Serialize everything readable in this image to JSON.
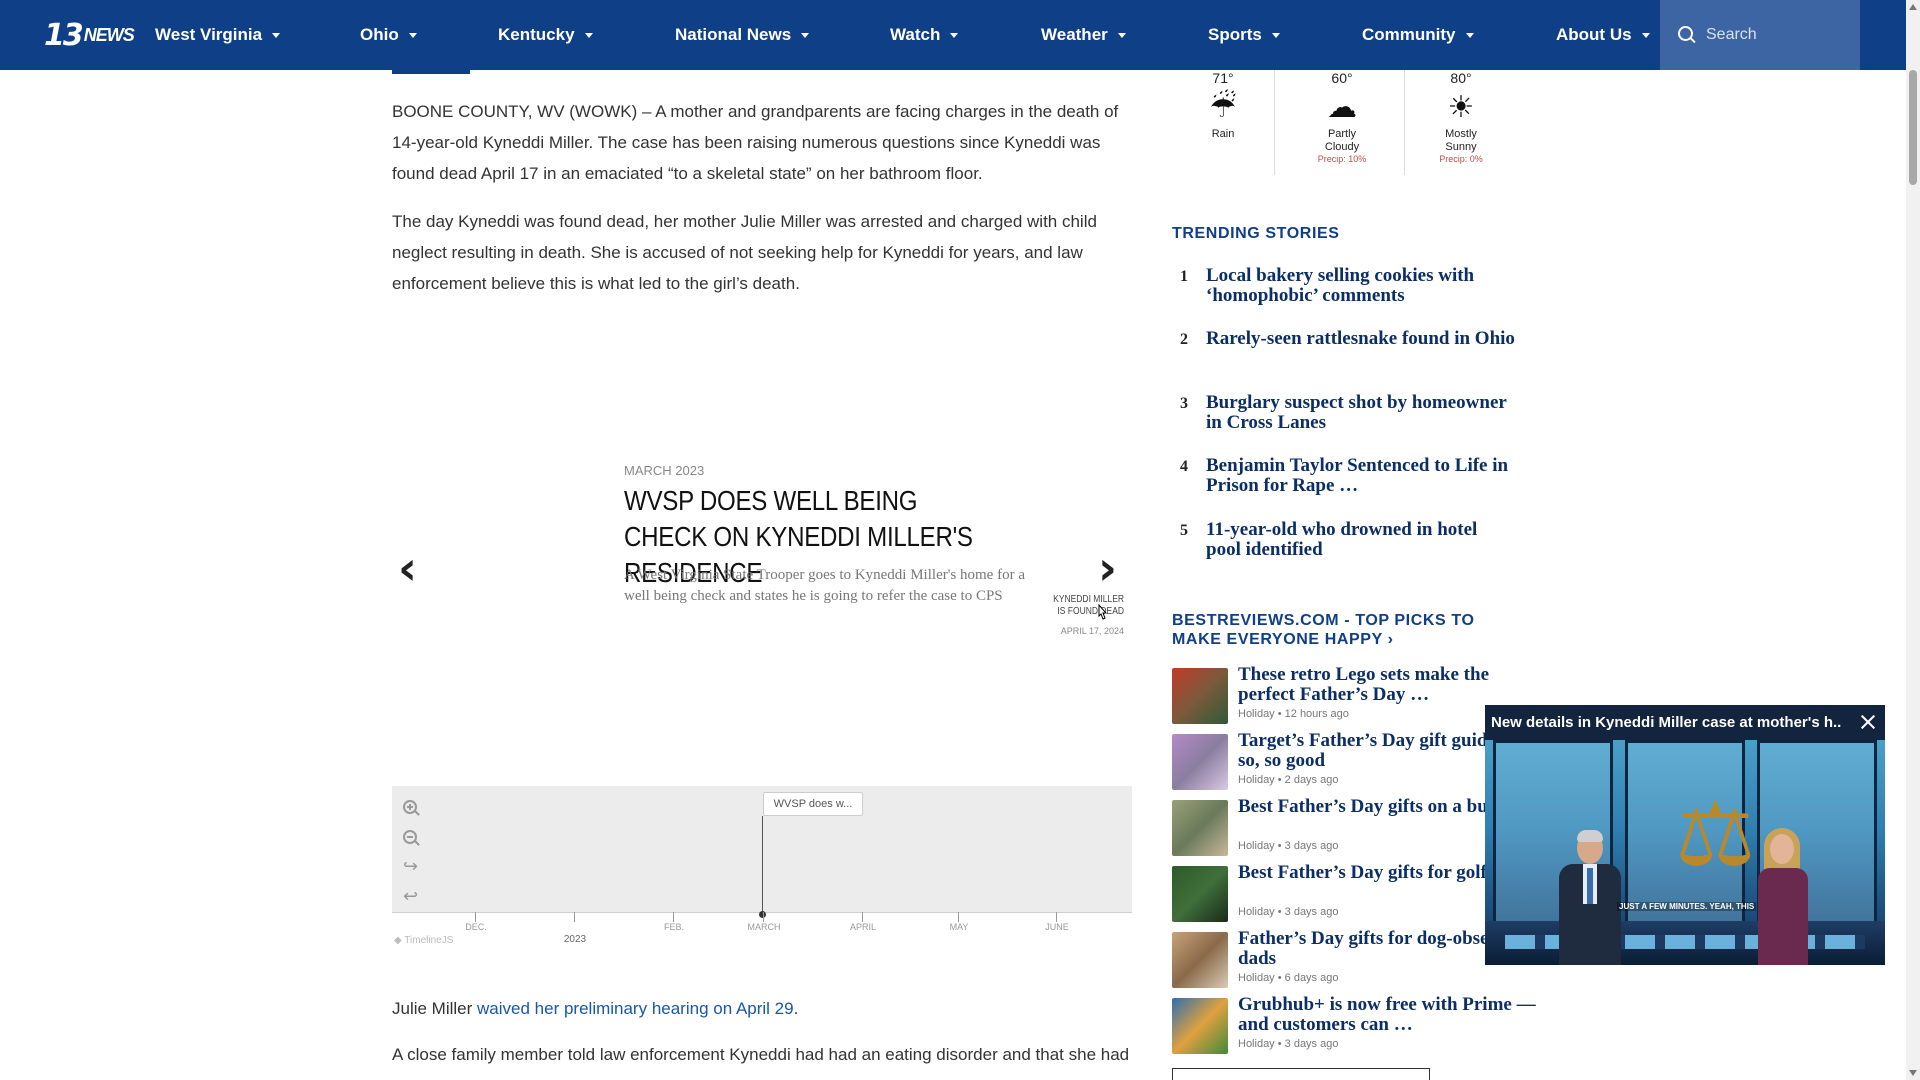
{
  "nav": {
    "items": [
      {
        "label": "West Virginia"
      },
      {
        "label": "Ohio"
      },
      {
        "label": "Kentucky"
      },
      {
        "label": "National News"
      },
      {
        "label": "Watch"
      },
      {
        "label": "Weather"
      },
      {
        "label": "Sports"
      },
      {
        "label": "Community"
      },
      {
        "label": "About Us"
      }
    ],
    "search_placeholder": "Search",
    "logo_number": "13",
    "logo_word": "NEWS"
  },
  "article": {
    "p1": "BOONE COUNTY, WV (WOWK) – A mother and grandparents are facing charges in the death of 14-year-old Kyneddi Miller. The case has been raising numerous questions since Kyneddi was found dead April 17 in an emaciated “to a skeletal state” on her bathroom floor.",
    "p2": "The day Kyneddi was found dead, her mother Julie Miller was arrested and charged with child neglect resulting in death. She is accused of not seeking help for Kyneddi for years, and law enforcement believe this is what led to the girl’s death.",
    "p3_prefix": "Julie Miller ",
    "p3_link": "waived her preliminary hearing on April 29",
    "p3_suffix": ".",
    "p4": "A close family member told law enforcement Kyneddi had had an eating disorder and that she had"
  },
  "timeline": {
    "date": "MARCH 2023",
    "headline": "WVSP DOES WELL BEING CHECK ON KYNEDDI MILLER'S RESIDENCE",
    "body": "A West Virginia State Trooper goes to Kyneddi Miller's home for a well being check and states he is going to refer the case to CPS",
    "next_label": "KYNEDDI MILLER IS FOUND DEAD",
    "next_date": "APRIL 17, 2024",
    "prev_glyph": "‹",
    "next_glyph": "›",
    "marker_label": "WVSP does w...",
    "ticks": [
      "DEC.",
      "FEB.",
      "MARCH",
      "APRIL",
      "MAY",
      "JUNE"
    ],
    "year": "2023",
    "credit": "◆ TimelineJS"
  },
  "weather": [
    {
      "temp": "71°",
      "icon": "rain-icon",
      "glyph": "☔",
      "cond": "Rain",
      "precip": ""
    },
    {
      "temp": "60°",
      "icon": "partly-cloudy-icon",
      "glyph": "☁",
      "cond": "Partly Cloudy",
      "precip": "Precip: 10%"
    },
    {
      "temp": "80°",
      "icon": "sun-icon",
      "glyph": "☀",
      "cond": "Mostly Sunny",
      "precip": "Precip: 0%"
    }
  ],
  "trending": {
    "title": "TRENDING STORIES",
    "items": [
      {
        "num": "1",
        "title": "Local bakery selling cookies with ‘homophobic’ comments"
      },
      {
        "num": "2",
        "title": "Rarely-seen rattlesnake found in Ohio"
      },
      {
        "num": "3",
        "title": "Burglary suspect shot by homeowner in Cross Lanes"
      },
      {
        "num": "4",
        "title": "Benjamin Taylor Sentenced to Life in Prison for Rape …"
      },
      {
        "num": "5",
        "title": "11-year-old who drowned in hotel pool identified"
      }
    ]
  },
  "bestreviews": {
    "title": "BESTREVIEWS.COM - TOP PICKS TO MAKE EVERYONE HAPPY ›",
    "items": [
      {
        "title": "These retro Lego sets make the perfect Father’s Day …",
        "meta": "Holiday • 12 hours ago",
        "color": "#7a5a3a"
      },
      {
        "title": "Target’s Father’s Day gift guide is so, so good",
        "meta": "Holiday • 2 days ago",
        "color": "#8a7ea0"
      },
      {
        "title": "Best Father’s Day gifts on a budget",
        "meta": "Holiday • 3 days ago",
        "color": "#6a7a5a"
      },
      {
        "title": "Best Father’s Day gifts for golfers",
        "meta": "Holiday • 3 days ago",
        "color": "#3f6f3a"
      },
      {
        "title": "Father’s Day gifts for dog-obsessed dads",
        "meta": "Holiday • 6 days ago",
        "color": "#8a6a4a"
      },
      {
        "title": "Grubhub+ is now free with Prime — and customers can …",
        "meta": "Holiday • 3 days ago",
        "color": "#2f6fb0"
      }
    ]
  },
  "video": {
    "title": "New details in Kyneddi Miller case at mother's h...",
    "caption": "JUST A FEW MINUTES. YEAH, THIS"
  }
}
